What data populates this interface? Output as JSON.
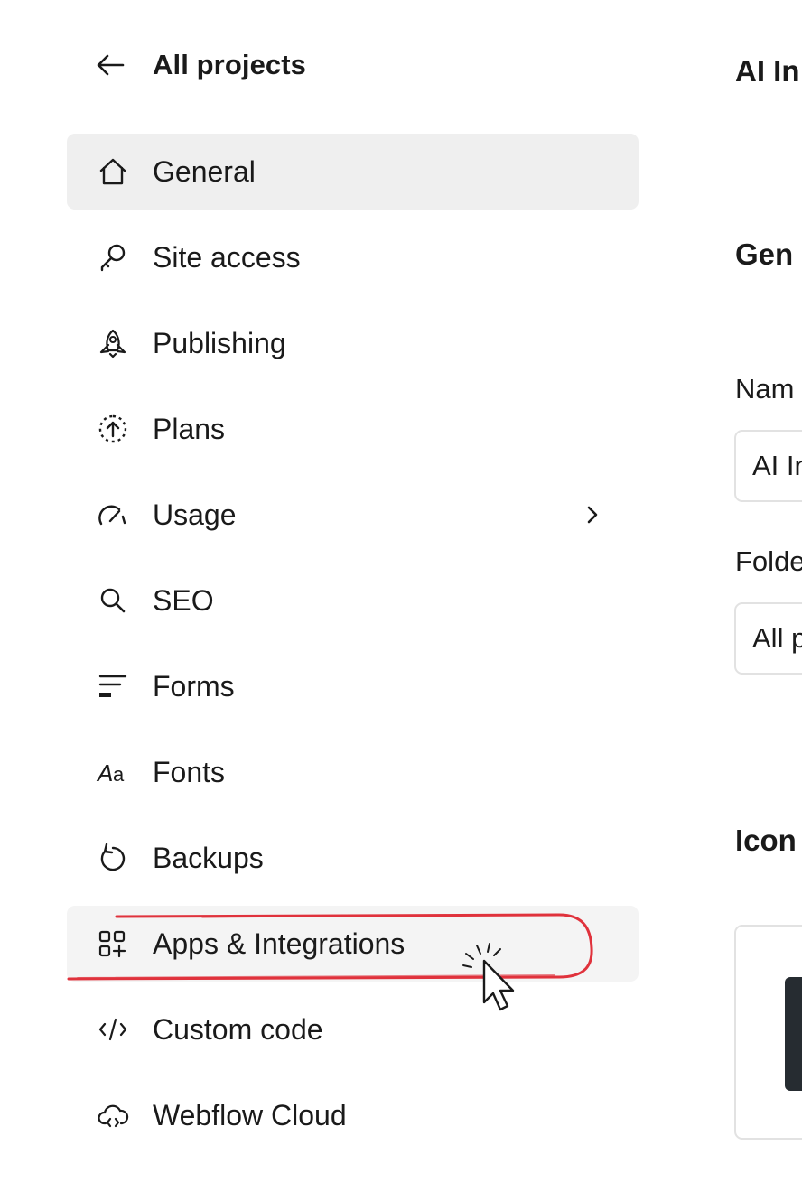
{
  "back_link": {
    "label": "All projects",
    "icon": "arrow-left-icon"
  },
  "nav": {
    "items": [
      {
        "label": "General",
        "icon": "home-icon",
        "active": true
      },
      {
        "label": "Site access",
        "icon": "key-icon"
      },
      {
        "label": "Publishing",
        "icon": "rocket-icon"
      },
      {
        "label": "Plans",
        "icon": "upgrade-icon"
      },
      {
        "label": "Usage",
        "icon": "gauge-icon",
        "has_submenu": true
      },
      {
        "label": "SEO",
        "icon": "search-icon"
      },
      {
        "label": "Forms",
        "icon": "form-icon"
      },
      {
        "label": "Fonts",
        "icon": "font-icon"
      },
      {
        "label": "Backups",
        "icon": "restore-icon"
      },
      {
        "label": "Apps & Integrations",
        "icon": "apps-icon",
        "hover": true,
        "highlighted": true
      },
      {
        "label": "Custom code",
        "icon": "code-icon"
      },
      {
        "label": "Webflow Cloud",
        "icon": "cloud-code-icon"
      }
    ]
  },
  "main": {
    "title": "AI In",
    "general_heading": "Gen",
    "name_label": "Nam",
    "name_value": "AI In",
    "folder_label": "Folde",
    "folder_value": "All p",
    "icon_heading": "Icon"
  },
  "colors": {
    "active_bg": "#efefef",
    "hover_bg": "#f4f4f4",
    "annotation_red": "#e0323c",
    "text": "#1a1a1a"
  }
}
